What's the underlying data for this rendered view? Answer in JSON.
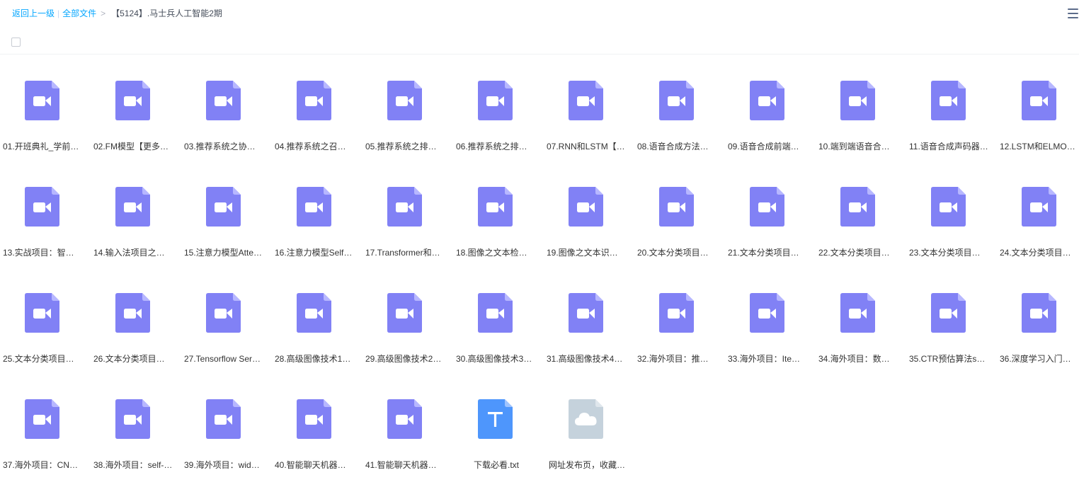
{
  "breadcrumb": {
    "back": "返回上一级",
    "all_files": "全部文件",
    "current": "【5124】.马士兵人工智能2期"
  },
  "icons": {
    "menu": "menu-icon",
    "video": "video-file-icon",
    "text": "text-file-icon",
    "cloud": "cloud-file-icon"
  },
  "colors": {
    "link": "#06a7ff",
    "video": "#8181f5",
    "video_fold": "#b7b7ff",
    "text": "#4e96fc",
    "text_fold": "#9fc4fe",
    "cloud": "#c5d2dc",
    "cloud_fold": "#dfe6ec"
  },
  "files": [
    {
      "name": "01.开班典礼_学前…",
      "type": "video"
    },
    {
      "name": "02.FM模型【更多…",
      "type": "video"
    },
    {
      "name": "03.推荐系统之协…",
      "type": "video"
    },
    {
      "name": "04.推荐系统之召…",
      "type": "video"
    },
    {
      "name": "05.推荐系统之排…",
      "type": "video"
    },
    {
      "name": "06.推荐系统之排…",
      "type": "video"
    },
    {
      "name": "07.RNN和LSTM【…",
      "type": "video"
    },
    {
      "name": "08.语音合成方法…",
      "type": "video"
    },
    {
      "name": "09.语音合成前端…",
      "type": "video"
    },
    {
      "name": "10.端到端语音合…",
      "type": "video"
    },
    {
      "name": "11.语音合成声码器…",
      "type": "video"
    },
    {
      "name": "12.LSTM和ELMO…",
      "type": "video"
    },
    {
      "name": "13.实战项目：智…",
      "type": "video"
    },
    {
      "name": "14.输入法项目之…",
      "type": "video"
    },
    {
      "name": "15.注意力模型Atte…",
      "type": "video"
    },
    {
      "name": "16.注意力模型Self…",
      "type": "video"
    },
    {
      "name": "17.Transformer和…",
      "type": "video"
    },
    {
      "name": "18.图像之文本检…",
      "type": "video"
    },
    {
      "name": "19.图像之文本识…",
      "type": "video"
    },
    {
      "name": "20.文本分类项目…",
      "type": "video"
    },
    {
      "name": "21.文本分类项目…",
      "type": "video"
    },
    {
      "name": "22.文本分类项目…",
      "type": "video"
    },
    {
      "name": "23.文本分类项目…",
      "type": "video"
    },
    {
      "name": "24.文本分类项目…",
      "type": "video"
    },
    {
      "name": "25.文本分类项目…",
      "type": "video"
    },
    {
      "name": "26.文本分类项目…",
      "type": "video"
    },
    {
      "name": "27.Tensorflow Ser…",
      "type": "video"
    },
    {
      "name": "28.高级图像技术1…",
      "type": "video"
    },
    {
      "name": "29.高级图像技术2…",
      "type": "video"
    },
    {
      "name": "30.高级图像技术3…",
      "type": "video"
    },
    {
      "name": "31.高级图像技术4…",
      "type": "video"
    },
    {
      "name": "32.海外项目：推…",
      "type": "video"
    },
    {
      "name": "33.海外项目：Ite…",
      "type": "video"
    },
    {
      "name": "34.海外项目：数…",
      "type": "video"
    },
    {
      "name": "35.CTR预估算法s…",
      "type": "video"
    },
    {
      "name": "36.深度学习入门…",
      "type": "video"
    },
    {
      "name": "37.海外项目：CN…",
      "type": "video"
    },
    {
      "name": "38.海外项目：self-…",
      "type": "video"
    },
    {
      "name": "39.海外项目：wid…",
      "type": "video"
    },
    {
      "name": "40.智能聊天机器…",
      "type": "video"
    },
    {
      "name": "41.智能聊天机器…",
      "type": "video"
    },
    {
      "name": "下载必看.txt",
      "type": "text"
    },
    {
      "name": "网址发布页，收藏…",
      "type": "cloud"
    }
  ]
}
